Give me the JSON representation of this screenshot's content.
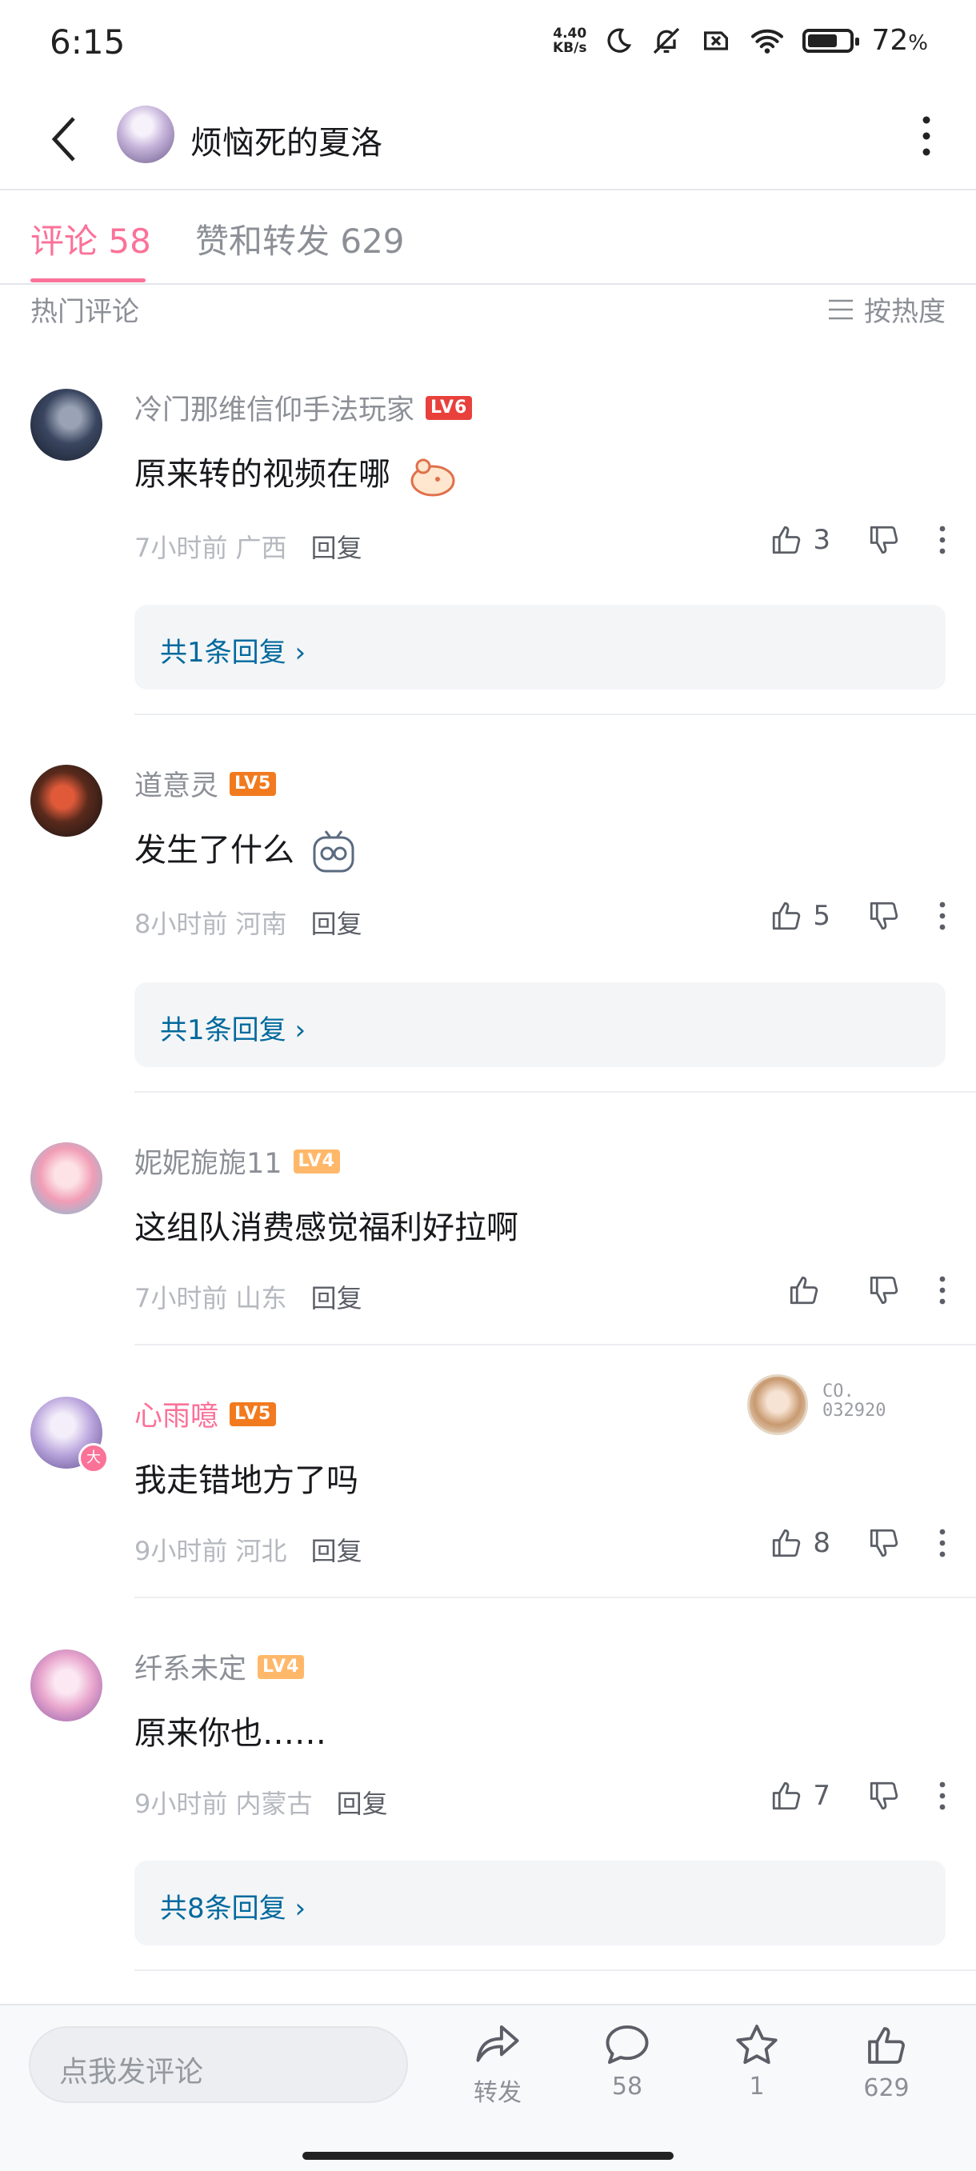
{
  "status_bar": {
    "time": "6:15",
    "net_speed_value": "4.40",
    "net_speed_unit": "KB/s",
    "battery": "72",
    "battery_unit": "%",
    "battery_level": 0.72
  },
  "header": {
    "title": "烦恼死的夏洛"
  },
  "tabs": [
    {
      "label": "评论 58",
      "active": true
    },
    {
      "label": "赞和转发 629",
      "active": false
    }
  ],
  "section": {
    "label": "热门评论",
    "sort_label": "按热度"
  },
  "comments": [
    {
      "username": "冷门那维信仰手法玩家",
      "level": "LV6",
      "text": "原来转的视频在哪",
      "time": "7小时前",
      "location": "广西",
      "reply_label": "回复",
      "likes": "3",
      "replies_label": "共1条回复"
    },
    {
      "username": "道意灵",
      "level": "LV5",
      "text": "发生了什么",
      "time": "8小时前",
      "location": "河南",
      "reply_label": "回复",
      "likes": "5",
      "replies_label": "共1条回复"
    },
    {
      "username": "妮妮旎旎11",
      "level": "LV4",
      "text": "这组队消费感觉福利好拉啊",
      "time": "7小时前",
      "location": "山东",
      "reply_label": "回复",
      "likes": ""
    },
    {
      "username": "心雨噫",
      "level": "LV5",
      "text": "我走错地方了吗",
      "time": "9小时前",
      "location": "河北",
      "reply_label": "回复",
      "likes": "8",
      "badge_code_line1": "CO.",
      "badge_code_line2": "032920",
      "avatar_badge": "大"
    },
    {
      "username": "纤系未定",
      "level": "LV4",
      "text": "原来你也……",
      "time": "9小时前",
      "location": "内蒙古",
      "reply_label": "回复",
      "likes": "7",
      "replies_label": "共8条回复"
    }
  ],
  "bottom_bar": {
    "input_placeholder": "点我发评论",
    "share_label": "转发",
    "comment_count": "58",
    "favorite_count": "1",
    "like_count": "629"
  },
  "colors": {
    "accent": "#fb7299",
    "reply_link": "#00699d",
    "lv6": "#e8413c",
    "lv5": "#f27a1e",
    "lv4": "#ffb86a"
  }
}
